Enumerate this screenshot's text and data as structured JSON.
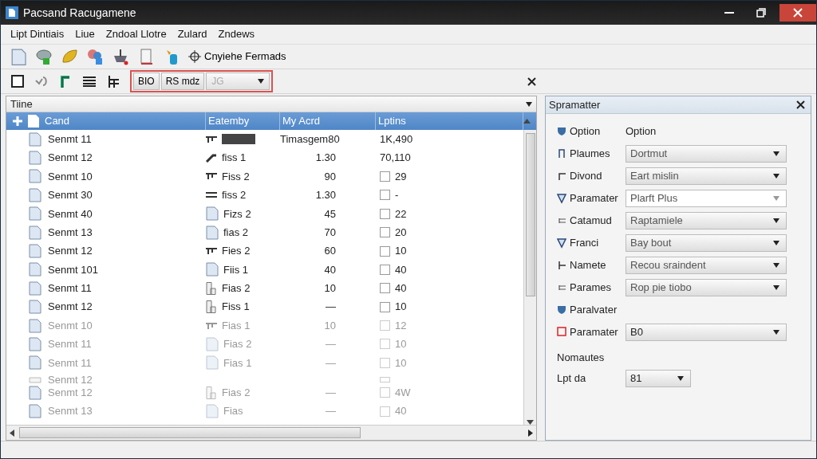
{
  "window": {
    "title": "Pacsand Racugamene"
  },
  "menu": [
    "Lipt Dintiais",
    "Liue",
    "Zndoal Llotre",
    "Zulard",
    "Zndews"
  ],
  "toolbar": {
    "command": "Cnyiehe Fermads"
  },
  "format_bar": {
    "buttons": [
      "BIO",
      "RS mdz"
    ],
    "combo": {
      "value": "JG",
      "disabled": true
    }
  },
  "left_panel": {
    "title": "Tiine",
    "columns": [
      "Cand",
      "Eatemby",
      "My Acrd",
      "Lptins"
    ],
    "rows": [
      {
        "name": "Senmt 11",
        "swatch": true,
        "amount": "Timasgem80",
        "option": "1K,490",
        "kind": "plain",
        "dimmed": false
      },
      {
        "name": "Senmt 12",
        "type": "fiss 1",
        "swatch": false,
        "amount": "1.30",
        "option": "70,110",
        "kind": "plain",
        "dimmed": false
      },
      {
        "name": "Senmt 10",
        "type": "Fiss 2",
        "swatch": false,
        "amount": "90",
        "option": "29",
        "kind": "checkbox",
        "checked": false,
        "dimmed": false
      },
      {
        "name": "Senmt 30",
        "type": "fiss 2",
        "swatch": false,
        "amount": "1.30",
        "option": "-",
        "kind": "checkbox",
        "checked": false,
        "dimmed": false
      },
      {
        "name": "Senmt 40",
        "type": "Fizs 2",
        "swatch": false,
        "amount": "45",
        "option": "22",
        "kind": "checkbox",
        "checked": false,
        "dimmed": false
      },
      {
        "name": "Senmt 13",
        "type": "fias 2",
        "swatch": false,
        "amount": "70",
        "option": "20",
        "kind": "checkbox",
        "checked": false,
        "dimmed": false
      },
      {
        "name": "Senmt 12",
        "type": "Fies 2",
        "swatch": false,
        "amount": "60",
        "option": "10",
        "kind": "checkbox",
        "checked": false,
        "dimmed": false
      },
      {
        "name": "Senmt 101",
        "type": "Fiis 1",
        "swatch": false,
        "amount": "40",
        "option": "40",
        "kind": "checkbox",
        "checked": false,
        "dimmed": false
      },
      {
        "name": "Senmt 11",
        "type": "Fias 2",
        "swatch": false,
        "amount": "10",
        "option": "40",
        "kind": "checkbox",
        "checked": false,
        "dimmed": false
      },
      {
        "name": "Senmt 12",
        "type": "Fiss 1",
        "swatch": false,
        "amount": "—",
        "option": "10",
        "kind": "checkbox",
        "checked": false,
        "dimmed": false
      },
      {
        "name": "Senmt 10",
        "type": "Fias 1",
        "swatch": false,
        "amount": "10",
        "option": "12",
        "kind": "checkbox",
        "checked": false,
        "dimmed": true
      },
      {
        "name": "Senmt 11",
        "type": "Fias 2",
        "swatch": false,
        "amount": "—",
        "option": "10",
        "kind": "checkbox",
        "checked": false,
        "dimmed": true
      },
      {
        "name": "Senmt 11",
        "type": "Fias 1",
        "swatch": false,
        "amount": "—",
        "option": "10",
        "kind": "checkbox",
        "checked": false,
        "dimmed": true
      },
      {
        "name": "Senmt 12",
        "swatch": false,
        "kind": "squeezed",
        "dimmed": true
      },
      {
        "name": "Senmt 12",
        "type": "Fias 2",
        "swatch": false,
        "amount": "—",
        "option": "4W",
        "kind": "checkbox",
        "checked": false,
        "dimmed": true
      },
      {
        "name": "Senmt 13",
        "type": "Fias",
        "swatch": false,
        "amount": "—",
        "option": "40",
        "kind": "checkbox",
        "checked": false,
        "dimmed": true
      }
    ]
  },
  "right_panel": {
    "title": "Spramatter",
    "rows": [
      {
        "label": "Option",
        "kind": "text",
        "value": "Option"
      },
      {
        "label": "Plaumes",
        "kind": "combo",
        "value": "Dortmut"
      },
      {
        "label": "Divond",
        "kind": "combo",
        "value": "Eart mislin"
      },
      {
        "label": "Paramater",
        "kind": "editable",
        "value": "Plarft Plus"
      },
      {
        "label": "Catamud",
        "kind": "combo",
        "value": "Raptamiele"
      },
      {
        "label": "Franci",
        "kind": "combo",
        "value": "Bay bout"
      },
      {
        "label": "Namete",
        "kind": "combo",
        "value": "Recou sraindent"
      },
      {
        "label": "Parames",
        "kind": "combo",
        "value": "Rop pie tiobo"
      },
      {
        "label": "Paralvater",
        "kind": "none"
      },
      {
        "label": "Paramater",
        "kind": "combo",
        "value": "B0"
      },
      {
        "label": "Nomautes",
        "kind": "heading"
      },
      {
        "label": "Lpt da",
        "kind": "small",
        "value": "81"
      }
    ]
  }
}
